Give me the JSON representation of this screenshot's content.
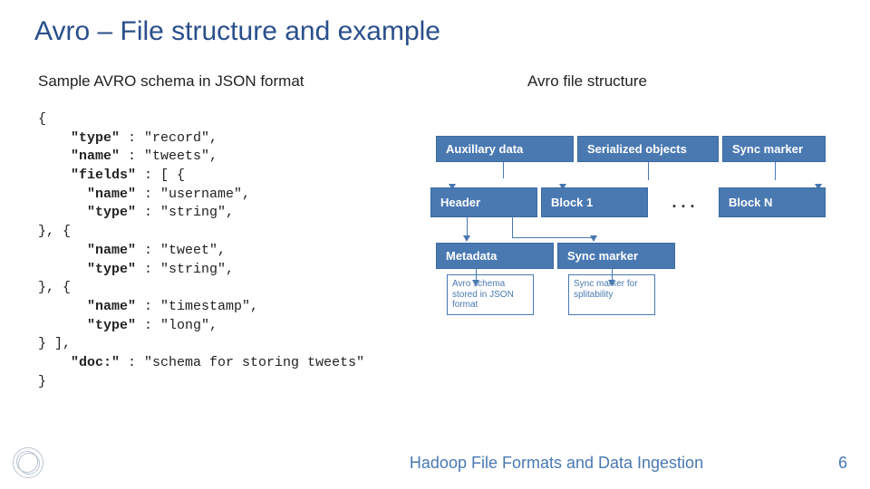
{
  "title": "Avro – File structure and example",
  "subtitle_left": "Sample AVRO schema in JSON format",
  "subtitle_right": "Avro file structure",
  "code_lines": [
    "{",
    "    \"type\" : \"record\",",
    "    \"name\" : \"tweets\",",
    "    \"fields\" : [ {",
    "      \"name\" : \"username\",",
    "      \"type\" : \"string\",",
    "}, {",
    "      \"name\" : \"tweet\",",
    "      \"type\" : \"string\",",
    "}, {",
    "      \"name\" : \"timestamp\",",
    "      \"type\" : \"long\",",
    "} ],",
    "    \"doc:\" : \"schema for storing tweets\"",
    "}"
  ],
  "code_keys": [
    "\"type\"",
    "\"name\"",
    "\"fields\"",
    "\"doc:\""
  ],
  "diagram": {
    "row1": {
      "aux": "Auxillary data",
      "ser": "Serialized objects",
      "sync": "Sync marker"
    },
    "row2": {
      "header": "Header",
      "b1": "Block 1",
      "dots": ". . .",
      "bn": "Block N"
    },
    "row3": {
      "meta": "Metadata",
      "sync": "Sync marker"
    },
    "notes": {
      "left": "Avro schema stored in JSON format",
      "right": "Sync marker for splitability"
    }
  },
  "footer": {
    "title": "Hadoop File Formats and Data Ingestion",
    "page": "6"
  }
}
